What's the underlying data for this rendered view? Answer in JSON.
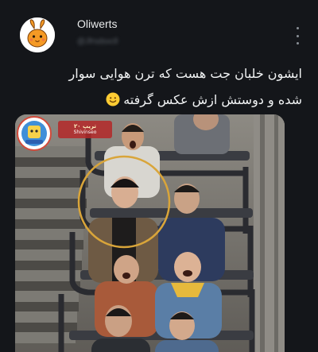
{
  "author": {
    "display_name": "Oliwerts",
    "handle": "@Jfrsdsxcll"
  },
  "post": {
    "line1": "ایشون خلبان جت هست که ترن هوایی سوار",
    "line2": "شده و دوستش ازش عکس گرفته"
  },
  "media": {
    "tag_top": "تریپ ۲۰",
    "tag_bottom": "Shivinseo"
  },
  "icons": {
    "avatar": "orange-bunny-avatar",
    "more": "more-options-icon",
    "emoji": "smiling-face-emoji"
  },
  "colors": {
    "background": "#14161a",
    "text": "#e7e9ea",
    "highlight_circle": "#d9a53a"
  }
}
